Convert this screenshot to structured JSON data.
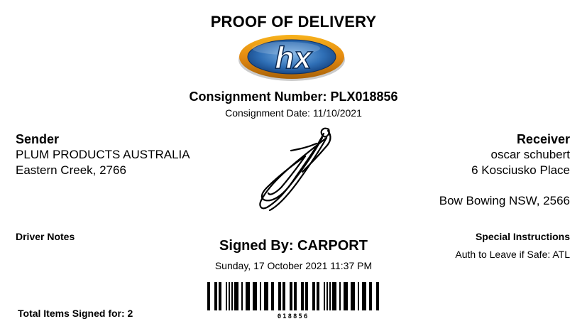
{
  "title": "PROOF OF DELIVERY",
  "logo": {
    "icon": "hx-logo",
    "text": "hx"
  },
  "consignment": {
    "number": "Consignment Number: PLX018856",
    "date": "Consignment Date: 11/10/2021"
  },
  "sender": {
    "heading": "Sender",
    "line1": "PLUM PRODUCTS AUSTRALIA",
    "line2": "Eastern Creek, 2766"
  },
  "receiver": {
    "heading": "Receiver",
    "line1": "oscar schubert",
    "line2": "6 Kosciusko Place",
    "line3": "Bow Bowing NSW, 2566"
  },
  "driver_notes": {
    "heading": "Driver Notes"
  },
  "special_instructions": {
    "heading": "Special Instructions",
    "text": "Auth to Leave if Safe: ATL"
  },
  "signature": {
    "icon": "handwritten-signature"
  },
  "signed": {
    "by": "Signed By: CARPORT",
    "datetime": "Sunday, 17 October 2021 11:37 PM"
  },
  "barcode": {
    "value": "018856"
  },
  "total_items": "Total Items Signed for: 2"
}
